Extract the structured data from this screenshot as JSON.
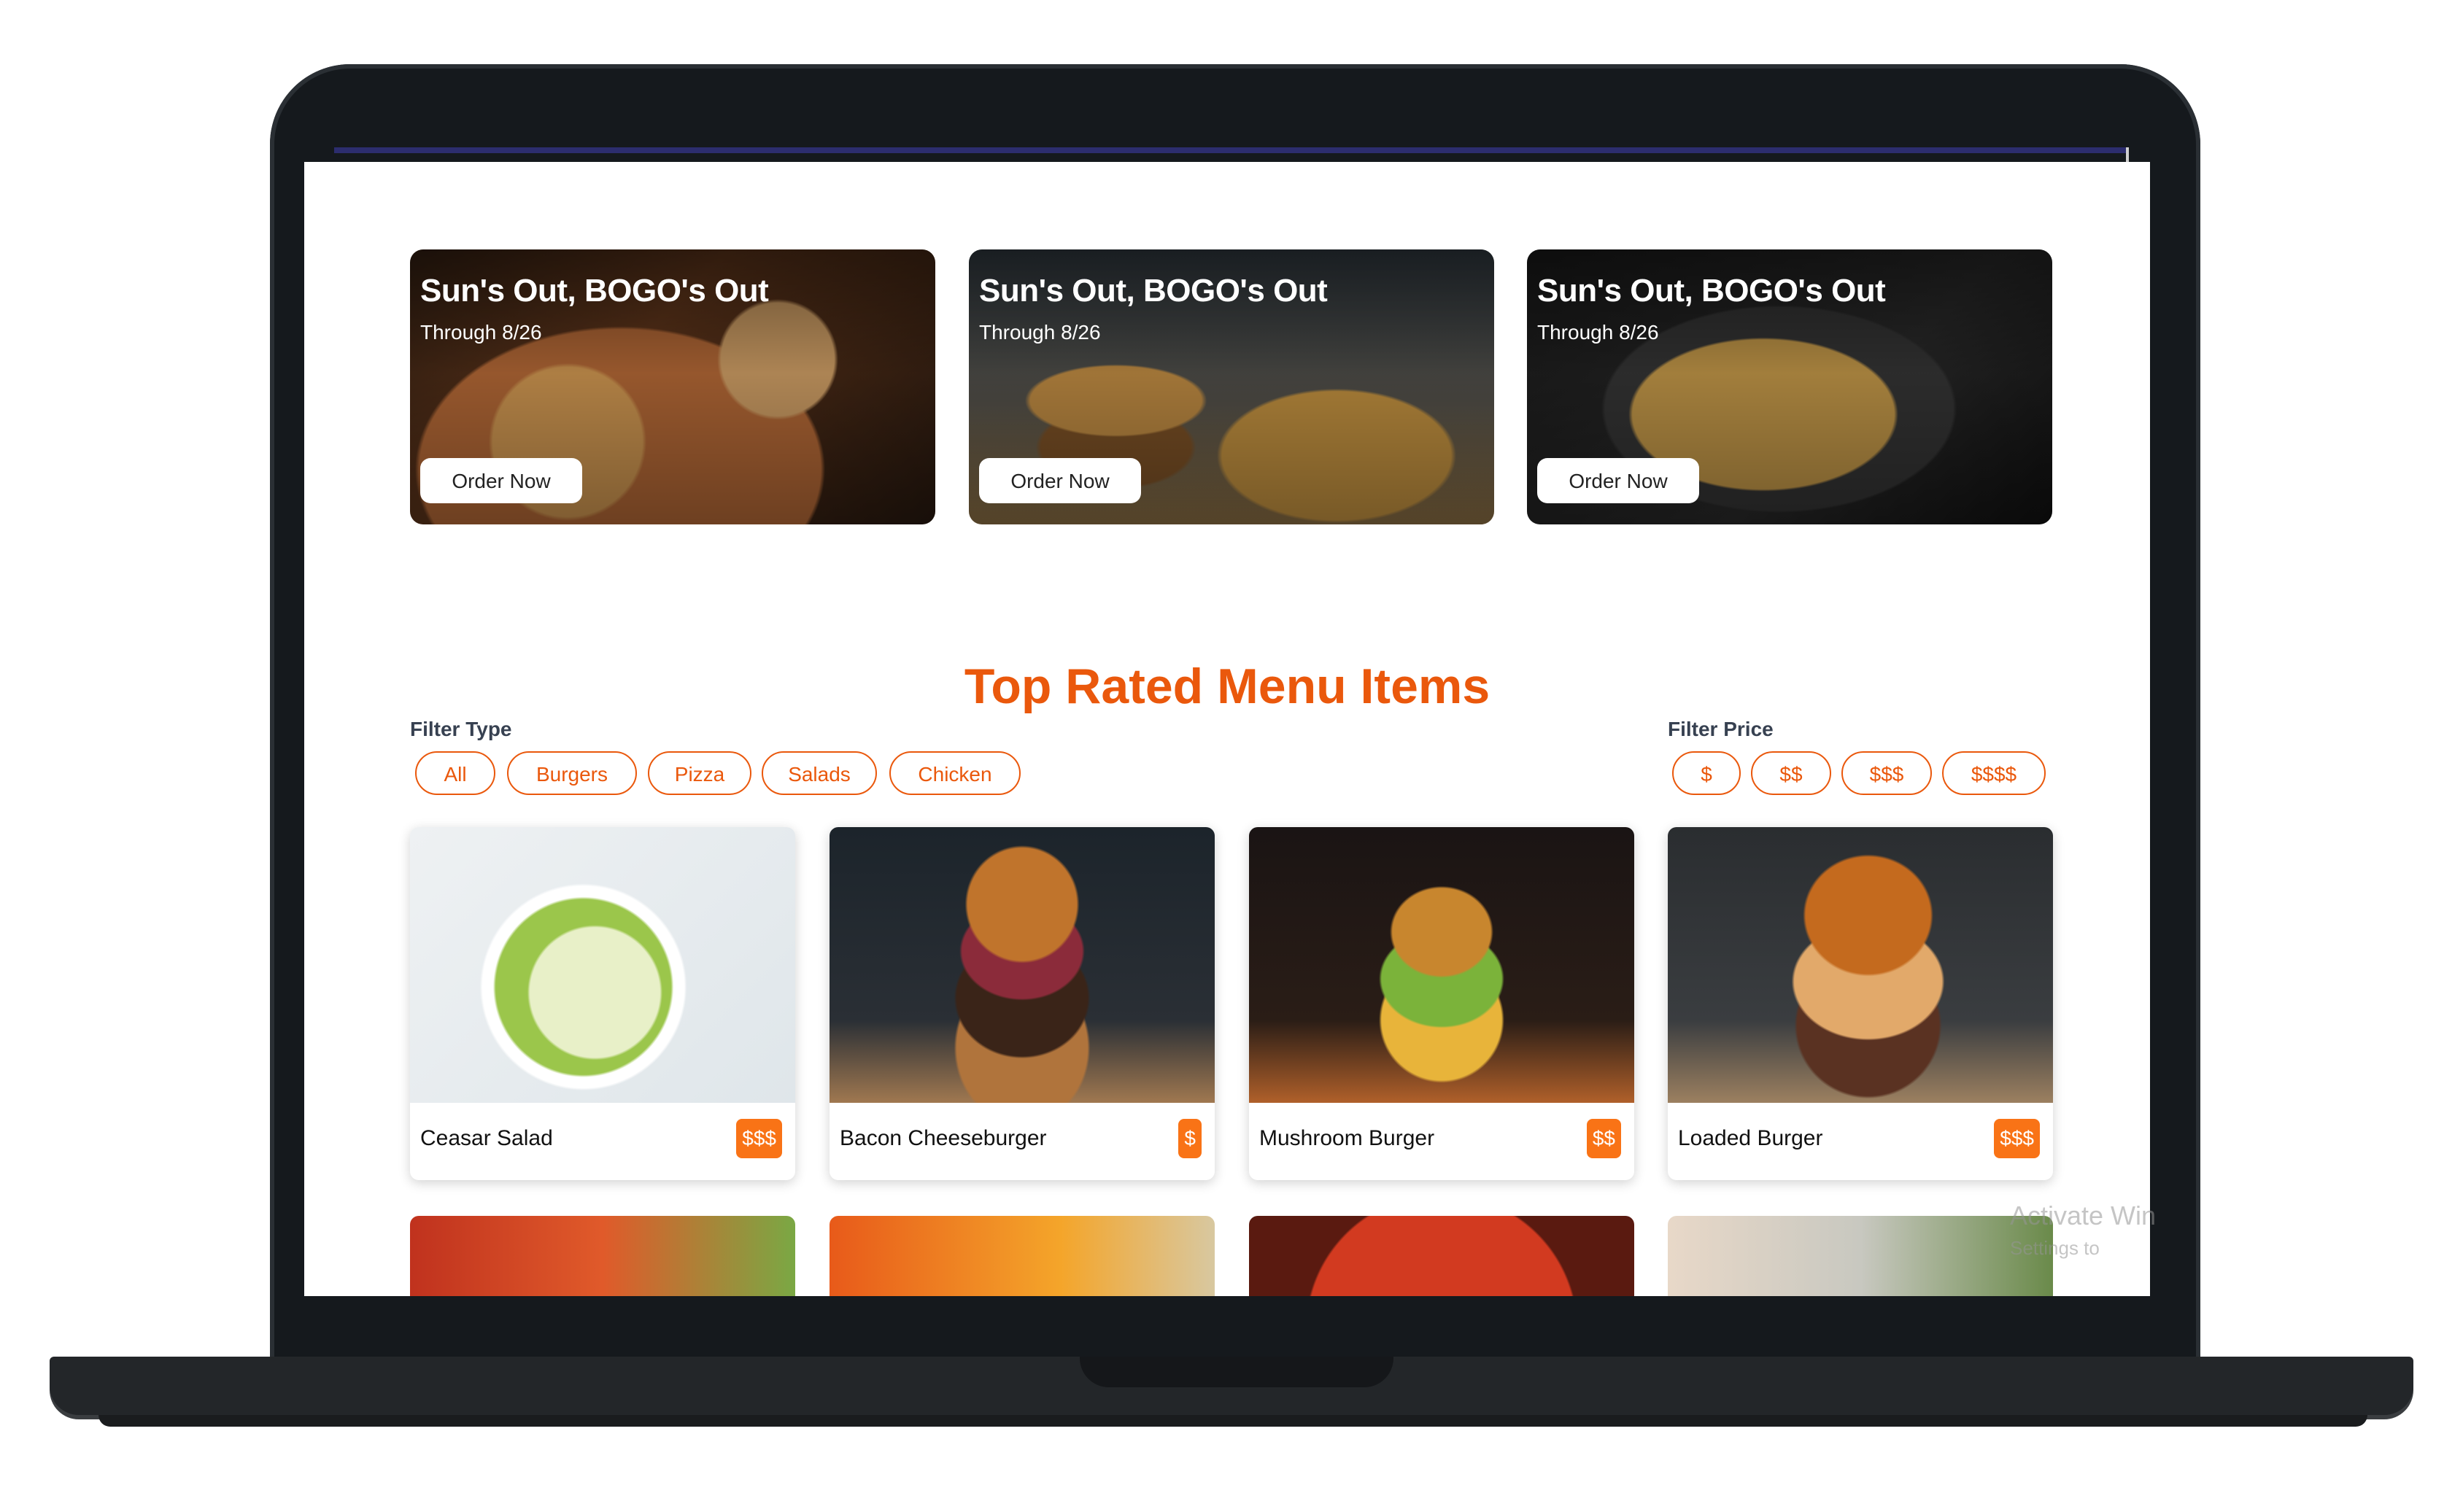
{
  "promos": [
    {
      "title": "Sun's Out, BOGO's Out",
      "subtitle": "Through 8/26",
      "button": "Order Now",
      "image": "pizza"
    },
    {
      "title": "Sun's Out, BOGO's Out",
      "subtitle": "Through 8/26",
      "button": "Order Now",
      "image": "burger-fries"
    },
    {
      "title": "Sun's Out, BOGO's Out",
      "subtitle": "Through 8/26",
      "button": "Order Now",
      "image": "noodles"
    }
  ],
  "menu": {
    "title": "Top Rated Menu Items",
    "filter_type": {
      "label": "Filter Type",
      "options": [
        "All",
        "Burgers",
        "Pizza",
        "Salads",
        "Chicken"
      ]
    },
    "filter_price": {
      "label": "Filter Price",
      "options": [
        "$",
        "$$",
        "$$$",
        "$$$$"
      ]
    },
    "items": [
      {
        "name": "Ceasar Salad",
        "price": "$$$"
      },
      {
        "name": "Bacon Cheeseburger",
        "price": "$"
      },
      {
        "name": "Mushroom Burger",
        "price": "$$"
      },
      {
        "name": "Loaded Burger",
        "price": "$$$"
      }
    ]
  },
  "watermark": {
    "line1": "Activate Win",
    "line2": "Settings to"
  },
  "colors": {
    "accent": "#ea580c",
    "price_badge": "#f97316",
    "frame": "#15191d"
  }
}
